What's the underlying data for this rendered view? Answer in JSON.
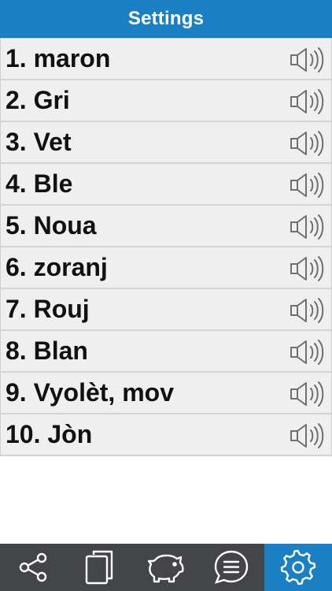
{
  "header": {
    "title": "Settings"
  },
  "words": [
    {
      "label": "1. maron"
    },
    {
      "label": "2. Gri"
    },
    {
      "label": "3. Vet"
    },
    {
      "label": "4. Ble"
    },
    {
      "label": "5. Noua"
    },
    {
      "label": "6. zoranj"
    },
    {
      "label": "7. Rouj"
    },
    {
      "label": "8. Blan"
    },
    {
      "label": "9. Vyolèt, mov"
    },
    {
      "label": "10. Jòn"
    }
  ],
  "tabbar": {
    "tabs": [
      {
        "icon": "share-icon"
      },
      {
        "icon": "cards-icon"
      },
      {
        "icon": "piggy-bank-icon"
      },
      {
        "icon": "chat-icon"
      },
      {
        "icon": "gear-icon",
        "active": true
      }
    ]
  },
  "colors": {
    "header_bg": "#1b7fc4",
    "row_bg": "#efefef",
    "tabbar_bg": "#444549",
    "active_tab_bg": "#1b7fc4"
  }
}
